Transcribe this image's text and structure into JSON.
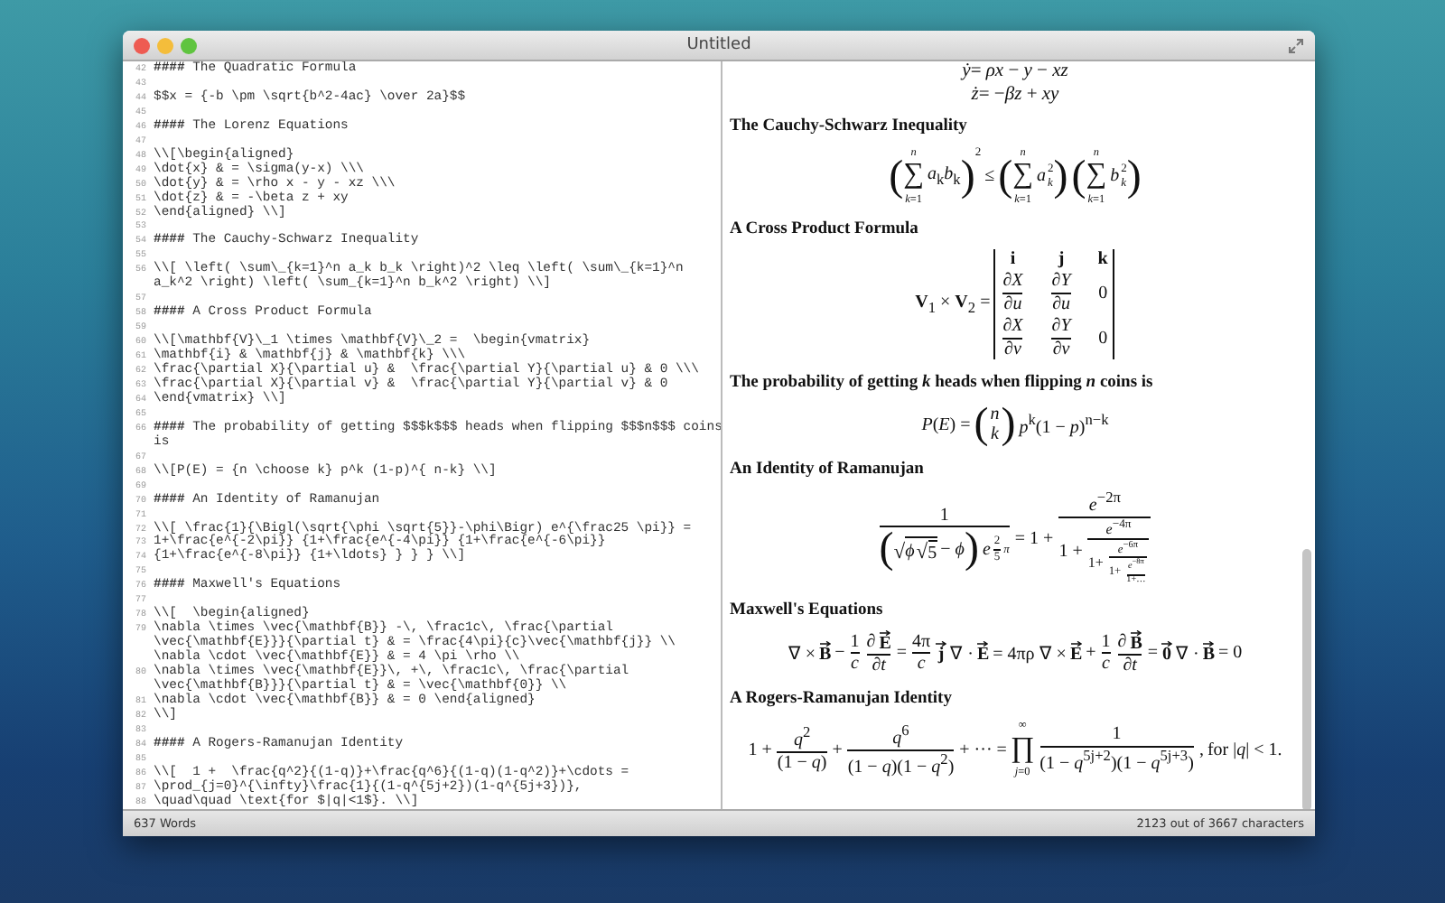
{
  "window": {
    "title": "Untitled"
  },
  "editor": {
    "lines": [
      {
        "number": "42",
        "rows": [
          "**####** The Quadratic Formula"
        ]
      },
      {
        "number": "43"
      },
      {
        "number": "44",
        "rows": [
          "$$x = {-b \\pm \\sqrt{b^2-4ac} \\over 2a}$$"
        ]
      },
      {
        "number": "45"
      },
      {
        "number": "46",
        "rows": [
          "**####** The Lorenz Equations"
        ]
      },
      {
        "number": "47"
      },
      {
        "number": "48",
        "rows": [
          "\\\\[\\begin{aligned}"
        ]
      },
      {
        "number": "49",
        "rows": [
          "\\dot{x} & = \\sigma(y-x) \\\\\\"
        ]
      },
      {
        "number": "50",
        "rows": [
          "\\dot{y} & = \\rho x - y - xz \\\\\\"
        ]
      },
      {
        "number": "51",
        "rows": [
          "\\dot{z} & = -\\beta z + xy"
        ]
      },
      {
        "number": "52",
        "rows": [
          "\\end{aligned} \\\\]"
        ]
      },
      {
        "number": "53"
      },
      {
        "number": "54",
        "rows": [
          "**####** The Cauchy-Schwarz Inequality"
        ]
      },
      {
        "number": "55"
      },
      {
        "number": "56",
        "rows": [
          "\\\\[ \\left( \\sum\\_{k=1}^n a_k b_k \\right)^2 \\leq \\left( \\sum\\_{k=1}^n",
          "a_k^2 \\right) \\left( \\sum_{k=1}^n b_k^2 \\right) \\\\]"
        ]
      },
      {
        "number": "57"
      },
      {
        "number": "58",
        "rows": [
          "**####** A Cross Product Formula"
        ]
      },
      {
        "number": "59"
      },
      {
        "number": "60",
        "rows": [
          "\\\\[\\mathbf{V}\\_1 \\times \\mathbf{V}\\_2 =  \\begin{vmatrix}"
        ]
      },
      {
        "number": "61",
        "rows": [
          "\\mathbf{i} & \\mathbf{j} & \\mathbf{k} \\\\\\"
        ]
      },
      {
        "number": "62",
        "rows": [
          "\\frac{\\partial X}{\\partial u} &  \\frac{\\partial Y}{\\partial u} & 0 \\\\\\"
        ]
      },
      {
        "number": "63",
        "rows": [
          "\\frac{\\partial X}{\\partial v} &  \\frac{\\partial Y}{\\partial v} & 0"
        ]
      },
      {
        "number": "64",
        "rows": [
          "\\end{vmatrix} \\\\]"
        ]
      },
      {
        "number": "65"
      },
      {
        "number": "66",
        "rows": [
          "**####** The probability of getting $$$k$$$ heads when flipping $$$n$$$ coins",
          "is"
        ]
      },
      {
        "number": "67"
      },
      {
        "number": "68",
        "rows": [
          "\\\\[P(E) = {n \\choose k} p^k (1-p)^{ n-k} \\\\]"
        ]
      },
      {
        "number": "69"
      },
      {
        "number": "70",
        "rows": [
          "**####** An Identity of Ramanujan"
        ]
      },
      {
        "number": "71"
      },
      {
        "number": "72",
        "rows": [
          "\\\\[ \\frac{1}{\\Bigl(\\sqrt{\\phi \\sqrt{5}}-\\phi\\Bigr) e^{\\frac25 \\pi}} ="
        ]
      },
      {
        "number": "73",
        "rows": [
          "1+\\frac{e^{-2\\pi}} {1+\\frac{e^{-4\\pi}} {1+\\frac{e^{-6\\pi}}"
        ]
      },
      {
        "number": "74",
        "rows": [
          "{1+\\frac{e^{-8\\pi}} {1+\\ldots} } } } \\\\]"
        ]
      },
      {
        "number": "75"
      },
      {
        "number": "76",
        "rows": [
          "**####** Maxwell's Equations"
        ]
      },
      {
        "number": "77"
      },
      {
        "number": "78",
        "rows": [
          "\\\\[  \\begin{aligned}"
        ]
      },
      {
        "number": "79",
        "rows": [
          "\\nabla \\times \\vec{\\mathbf{B}} -\\, \\frac1c\\, \\frac{\\partial",
          "\\vec{\\mathbf{E}}}{\\partial t} & = \\frac{4\\pi}{c}\\vec{\\mathbf{j}} \\\\",
          "\\nabla \\cdot \\vec{\\mathbf{E}} & = 4 \\pi \\rho \\\\"
        ]
      },
      {
        "number": "80",
        "rows": [
          "\\nabla \\times \\vec{\\mathbf{E}}\\, +\\, \\frac1c\\, \\frac{\\partial",
          "\\vec{\\mathbf{B}}}{\\partial t} & = \\vec{\\mathbf{0}} \\\\"
        ]
      },
      {
        "number": "81",
        "rows": [
          "\\nabla \\cdot \\vec{\\mathbf{B}} & = 0 \\end{aligned}"
        ]
      },
      {
        "number": "82",
        "rows": [
          "\\\\]"
        ]
      },
      {
        "number": "83"
      },
      {
        "number": "84",
        "rows": [
          "**####** A Rogers-Ramanujan Identity"
        ]
      },
      {
        "number": "85"
      },
      {
        "number": "86",
        "rows": [
          "\\\\[  1 +  \\frac{q^2}{(1-q)}+\\frac{q^6}{(1-q)(1-q^2)}+\\cdots ="
        ]
      },
      {
        "number": "87",
        "rows": [
          "\\prod_{j=0}^{\\infty}\\frac{1}{(1-q^{5j+2})(1-q^{5j+3})},"
        ]
      },
      {
        "number": "88",
        "rows": [
          "\\quad\\quad \\text{for $|q|<1$}. \\\\]"
        ]
      }
    ]
  },
  "preview": {
    "blocks": [
      {
        "kind": "lines",
        "lines": [
          "*ẏ*= *ρx* − *y* − *xz*",
          "*ż*= −*βz* + *xy*"
        ]
      },
      {
        "kind": "heading",
        "text": "The Cauchy-Schwarz Inequality"
      },
      {
        "kind": "formula",
        "pieces": [
          {
            "kind": "paren",
            "left": "(",
            "right": ")",
            "sup": "2",
            "body": [
              {
                "kind": "op",
                "symbol": "∑",
                "top": "*n*",
                "bottom": "*k*=1"
              },
              {
                "kind": "t",
                "text": "*a*$_{k}$*b*$_{k}$"
              }
            ]
          },
          {
            "kind": "t",
            "text": "≤"
          },
          {
            "kind": "paren",
            "left": "(",
            "right": ")",
            "body": [
              {
                "kind": "op",
                "symbol": "∑",
                "top": "*n*",
                "bottom": "*k*=1"
              },
              {
                "kind": "ss",
                "base": "*a*",
                "sup": "2",
                "sub": "*k*"
              }
            ]
          },
          {
            "kind": "paren",
            "left": "(",
            "right": ")",
            "body": [
              {
                "kind": "op",
                "symbol": "∑",
                "top": "*n*",
                "bottom": "*k*=1"
              },
              {
                "kind": "ss",
                "base": "*b*",
                "sup": "2",
                "sub": "*k*"
              }
            ]
          }
        ]
      },
      {
        "kind": "heading",
        "text": "A Cross Product Formula"
      },
      {
        "kind": "formula",
        "pieces": [
          {
            "kind": "t",
            "text": "**V**$_{1}$ × **V**$_{2}$ ="
          },
          {
            "kind": "matrix",
            "rows": [
              [
                "**i**",
                "**j**",
                "**k**"
              ],
              [
                [
                  {
                    "kind": "frac",
                    "num": "∂*X*",
                    "den": "∂*u*"
                  }
                ],
                [
                  {
                    "kind": "frac",
                    "num": "∂*Y*",
                    "den": "∂*u*"
                  }
                ],
                "0"
              ],
              [
                [
                  {
                    "kind": "frac",
                    "num": "∂*X*",
                    "den": "∂*v*"
                  }
                ],
                [
                  {
                    "kind": "frac",
                    "num": "∂*Y*",
                    "den": "∂*v*"
                  }
                ],
                "0"
              ]
            ]
          }
        ]
      },
      {
        "kind": "heading",
        "text": "The probability of getting *k* heads when flipping *n* coins is"
      },
      {
        "kind": "formula",
        "pieces": [
          {
            "kind": "t",
            "text": "*P*(*E*) ="
          },
          {
            "kind": "paren",
            "left": "(",
            "right": ")",
            "body": [
              {
                "kind": "stack",
                "top": "*n*",
                "bottom": "*k*"
              }
            ]
          },
          {
            "kind": "t",
            "text": "*p*$^{k}$(1 − *p*)$^{n−k}$"
          }
        ]
      },
      {
        "kind": "heading",
        "text": "An Identity of Ramanujan"
      },
      {
        "kind": "formula",
        "pieces": [
          {
            "kind": "frac",
            "num": "1",
            "den": [
              {
                "kind": "paren",
                "left": "(",
                "right": ")",
                "body": [
                  {
                    "kind": "sqrt",
                    "radical": "√",
                    "body": [
                      {
                        "kind": "t",
                        "text": "*ϕ*"
                      },
                      {
                        "kind": "sqrt",
                        "radical": "√",
                        "body": "5"
                      }
                    ]
                  },
                  {
                    "kind": "t",
                    "text": "− *ϕ*"
                  }
                ]
              },
              {
                "kind": "ss",
                "base": "*e*",
                "sup": [
                  {
                    "kind": "frac",
                    "num": "2",
                    "den": "5"
                  },
                  {
                    "kind": "t",
                    "text": "*π*"
                  }
                ]
              }
            ]
          },
          {
            "kind": "t",
            "text": "= 1 +"
          },
          {
            "kind": "frac",
            "num": "*e*$^{−2π}$",
            "den": [
              {
                "kind": "t",
                "text": "1 +"
              },
              {
                "kind": "frac",
                "num": "*e*$^{−4π}$",
                "den": [
                  {
                    "kind": "t",
                    "text": "1+"
                  },
                  {
                    "kind": "frac",
                    "num": "*e*$^{−6π}$",
                    "den": [
                      {
                        "kind": "t",
                        "text": "1+"
                      },
                      {
                        "kind": "frac",
                        "num": "*e*$^{−8π}$",
                        "den": "1+…"
                      }
                    ]
                  }
                ]
              }
            ]
          }
        ]
      },
      {
        "kind": "heading",
        "text": "Maxwell's Equations"
      },
      {
        "kind": "formula",
        "pieces": [
          {
            "kind": "t",
            "text": "∇ ×"
          },
          {
            "kind": "vec",
            "base": "**B**"
          },
          {
            "kind": "t",
            "text": "−"
          },
          {
            "kind": "frac",
            "num": "1",
            "den": "*c*"
          },
          {
            "kind": "frac",
            "num": [
              {
                "kind": "t",
                "text": "∂"
              },
              {
                "kind": "vec",
                "base": "**E**"
              }
            ],
            "den": "∂*t*"
          },
          {
            "kind": "t",
            "text": "="
          },
          {
            "kind": "frac",
            "num": "4π",
            "den": "*c*"
          },
          {
            "kind": "vec",
            "base": "**j**"
          },
          {
            "kind": "t",
            "text": "∇ ·"
          },
          {
            "kind": "vec",
            "base": "**E**"
          },
          {
            "kind": "t",
            "text": "= 4πρ ∇ ×"
          },
          {
            "kind": "vec",
            "base": "**E**"
          },
          {
            "kind": "t",
            "text": "+"
          },
          {
            "kind": "frac",
            "num": "1",
            "den": "*c*"
          },
          {
            "kind": "frac",
            "num": [
              {
                "kind": "t",
                "text": "∂"
              },
              {
                "kind": "vec",
                "base": "**B**"
              }
            ],
            "den": "∂*t*"
          },
          {
            "kind": "t",
            "text": "="
          },
          {
            "kind": "vec",
            "base": "**0**"
          },
          {
            "kind": "t",
            "text": "∇ ·"
          },
          {
            "kind": "vec",
            "base": "**B**"
          },
          {
            "kind": "t",
            "text": "= 0"
          }
        ]
      },
      {
        "kind": "heading",
        "text": "A Rogers-Ramanujan Identity"
      },
      {
        "kind": "formula",
        "pieces": [
          {
            "kind": "t",
            "text": "1 +"
          },
          {
            "kind": "frac",
            "num": "*q*$^{2}$",
            "den": "(1 − *q*)"
          },
          {
            "kind": "t",
            "text": "+"
          },
          {
            "kind": "frac",
            "num": "*q*$^{6}$",
            "den": "(1 − *q*)(1 − *q*$^{2}$)"
          },
          {
            "kind": "t",
            "text": "+ ··· ="
          },
          {
            "kind": "op",
            "symbol": "∏",
            "top": "∞",
            "bottom": "*j*=0"
          },
          {
            "kind": "frac",
            "num": "1",
            "den": "(1 − *q*$^{5j+2}$)(1 − *q*$^{5j+3}$)"
          },
          {
            "kind": "t",
            "text": ","
          },
          {
            "kind": "t",
            "text": "for |*q*| < 1."
          }
        ]
      }
    ]
  },
  "status_bar": {
    "words": "637 Words",
    "characters": "2123 out of 3667 characters"
  }
}
